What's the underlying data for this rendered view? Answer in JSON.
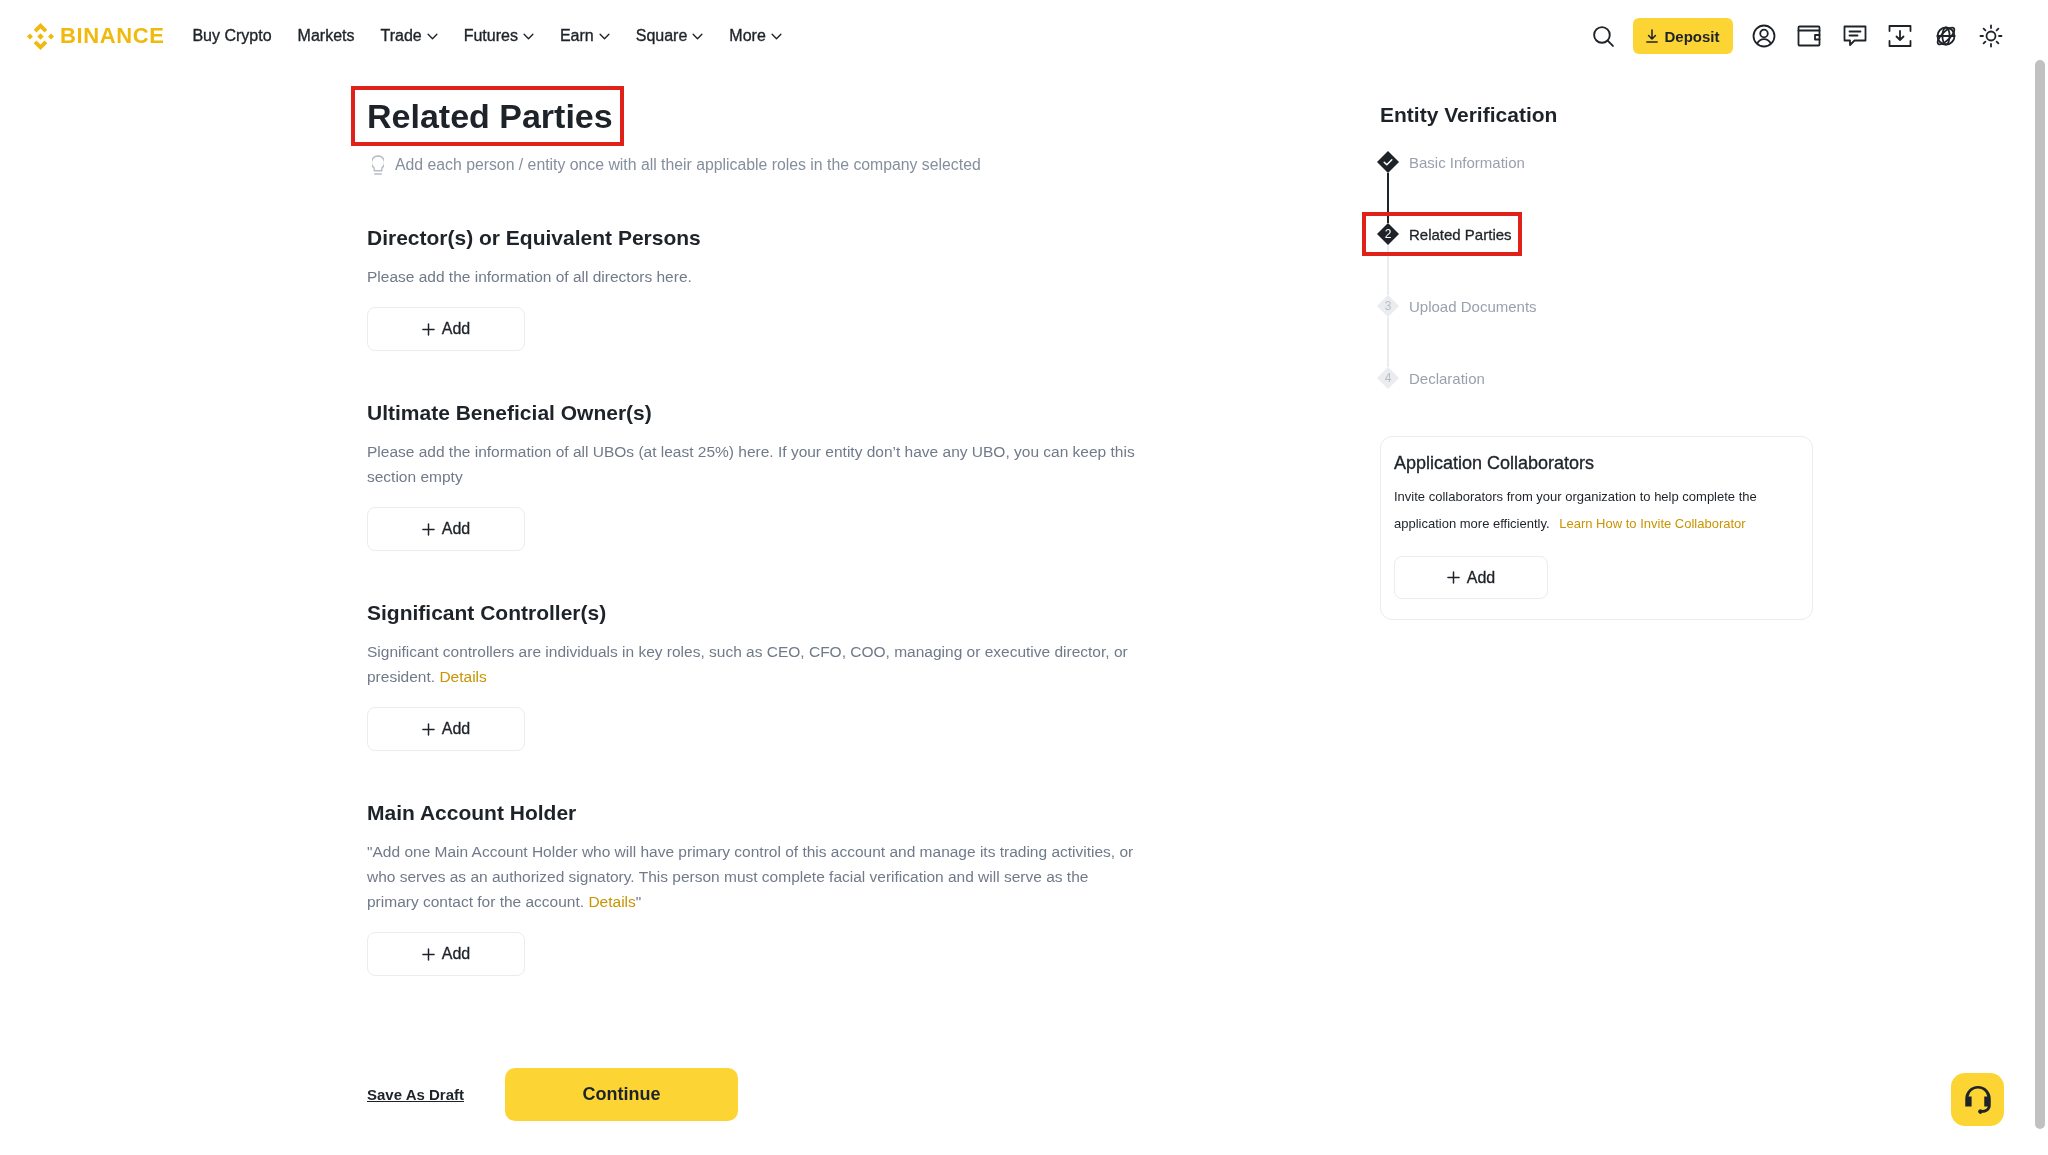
{
  "nav": {
    "logo_text": "BINANCE",
    "items": [
      {
        "label": "Buy Crypto",
        "dropdown": false
      },
      {
        "label": "Markets",
        "dropdown": false
      },
      {
        "label": "Trade",
        "dropdown": true
      },
      {
        "label": "Futures",
        "dropdown": true
      },
      {
        "label": "Earn",
        "dropdown": true
      },
      {
        "label": "Square",
        "dropdown": true
      },
      {
        "label": "More",
        "dropdown": true
      }
    ],
    "deposit_label": "Deposit"
  },
  "page": {
    "title": "Related Parties",
    "title_highlighted": true,
    "hint": "Add each person / entity once with all their applicable roles in the company selected"
  },
  "sections": [
    {
      "heading": "Director(s) or Equivalent Persons",
      "description": [
        {
          "kind": "text",
          "text": "Please add the information of all directors here."
        }
      ],
      "add_label": "Add"
    },
    {
      "heading": "Ultimate Beneficial Owner(s)",
      "description": [
        {
          "kind": "text",
          "text": "Please add the information of all UBOs (at least 25%) here. If your entity don’t have any UBO, you can keep this section empty"
        }
      ],
      "add_label": "Add"
    },
    {
      "heading": "Significant Controller(s)",
      "description": [
        {
          "kind": "text",
          "text": "Significant controllers are individuals in key roles, such as CEO, CFO, COO, managing or executive director, or president. "
        },
        {
          "kind": "link",
          "text": "Details"
        }
      ],
      "add_label": "Add"
    },
    {
      "heading": "Main Account Holder",
      "description": [
        {
          "kind": "text",
          "text": "\"Add one Main Account Holder who will have primary control of this account and manage its trading activities, or who serves as an authorized signatory. This person must complete facial verification and will serve as the primary contact for the account. "
        },
        {
          "kind": "link",
          "text": "Details"
        },
        {
          "kind": "text",
          "text": "\""
        }
      ],
      "add_label": "Add"
    }
  ],
  "footer": {
    "save_draft": "Save As Draft",
    "continue": "Continue"
  },
  "progress": {
    "title": "Entity Verification",
    "steps": [
      {
        "label": "Basic Information",
        "completed": true,
        "selected": false,
        "highlighted": false
      },
      {
        "label": "Related Parties",
        "number": "2",
        "completed": false,
        "selected": true,
        "highlighted": true
      },
      {
        "label": "Upload Documents",
        "number": "3",
        "completed": false,
        "selected": false,
        "highlighted": false
      },
      {
        "label": "Declaration",
        "number": "4",
        "completed": false,
        "selected": false,
        "highlighted": false
      }
    ]
  },
  "collaborators": {
    "title": "Application Collaborators",
    "description": "Invite collaborators from your organization to help complete the application more efficiently.",
    "link": "Learn How to Invite Collaborator",
    "add_label": "Add"
  }
}
